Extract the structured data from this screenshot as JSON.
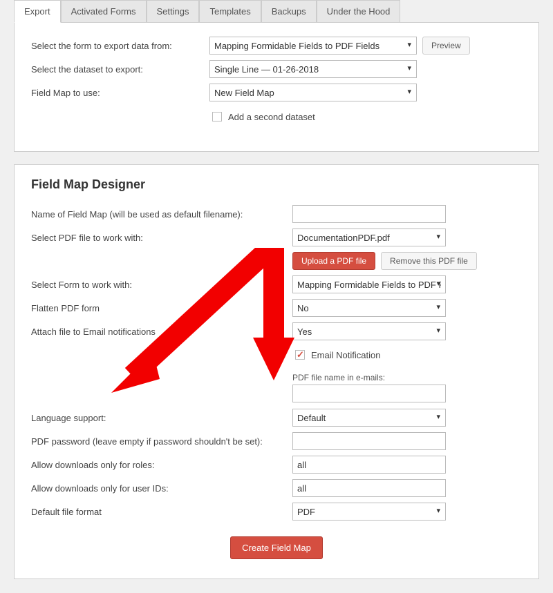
{
  "tabs": [
    "Export",
    "Activated Forms",
    "Settings",
    "Templates",
    "Backups",
    "Under the Hood"
  ],
  "export": {
    "row1_label": "Select the form to export data from:",
    "row1_value": "Mapping Formidable Fields to PDF Fields",
    "preview_btn": "Preview",
    "row2_label": "Select the dataset to export:",
    "row2_value": "Single Line — 01-26-2018",
    "row3_label": "Field Map to use:",
    "row3_value": "New Field Map",
    "add_second_dataset": "Add a second dataset"
  },
  "designer": {
    "heading": "Field Map Designer",
    "name_label": "Name of Field Map (will be used as default filename):",
    "name_value": "",
    "pdf_label": "Select PDF file to work with:",
    "pdf_value": "DocumentationPDF.pdf",
    "upload_btn": "Upload a PDF file",
    "remove_btn": "Remove this PDF file",
    "form_label": "Select Form to work with:",
    "form_value": "Mapping Formidable Fields to PDF Fields",
    "flatten_label": "Flatten PDF form",
    "flatten_value": "No",
    "attach_label": "Attach file to Email notifications",
    "attach_value": "Yes",
    "email_notif_cb": "Email Notification",
    "pdf_email_label": "PDF file name in e-mails:",
    "pdf_email_value": "",
    "lang_label": "Language support:",
    "lang_value": "Default",
    "pwd_label": "PDF password",
    "pwd_hint": "(leave empty if password shouldn't be set)",
    "pwd_value": "",
    "roles_label": "Allow downloads only for roles:",
    "roles_value": "all",
    "userids_label": "Allow downloads only for user IDs:",
    "userids_value": "all",
    "format_label": "Default file format",
    "format_value": "PDF",
    "create_btn": "Create Field Map"
  }
}
